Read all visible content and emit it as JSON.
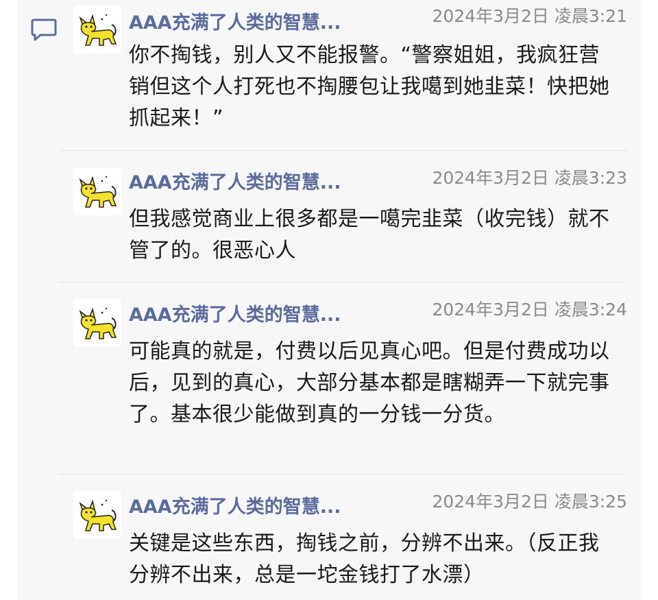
{
  "thread": {
    "comments": [
      {
        "author": "AAA充满了人类的智慧...",
        "timestamp": "2024年3月2日 凌晨3:21",
        "body": "你不掏钱，别人又不能报警。“警察姐姐，我疯狂营销但这个人打死也不掏腰包让我噶到她韭菜！快把她抓起来！”"
      },
      {
        "author": "AAA充满了人类的智慧...",
        "timestamp": "2024年3月2日 凌晨3:23",
        "body": "但我感觉商业上很多都是一噶完韭菜（收完钱）就不管了的。很恶心人"
      },
      {
        "author": "AAA充满了人类的智慧...",
        "timestamp": "2024年3月2日 凌晨3:24",
        "body": "可能真的就是，付费以后见真心吧。但是付费成功以后，见到的真心，大部分基本都是瞎糊弄一下就完事了。基本很少能做到真的一分钱一分货。"
      },
      {
        "author": "AAA充满了人类的智慧...",
        "timestamp": "2024年3月2日 凌晨3:25",
        "body": "关键是这些东西，掏钱之前，分辨不出来。（反正我分辨不出来，总是一坨金钱打了水漂）"
      }
    ]
  },
  "icons": {
    "comment": "comment-bubble-icon",
    "avatar": "yellow-cat-avatar"
  },
  "colors": {
    "author": "#5a6b9c",
    "timestamp": "#8a8a8a",
    "icon": "#5a6b9c",
    "panel": "#f7f7f7",
    "avatar_cat": "#f4e12a"
  }
}
